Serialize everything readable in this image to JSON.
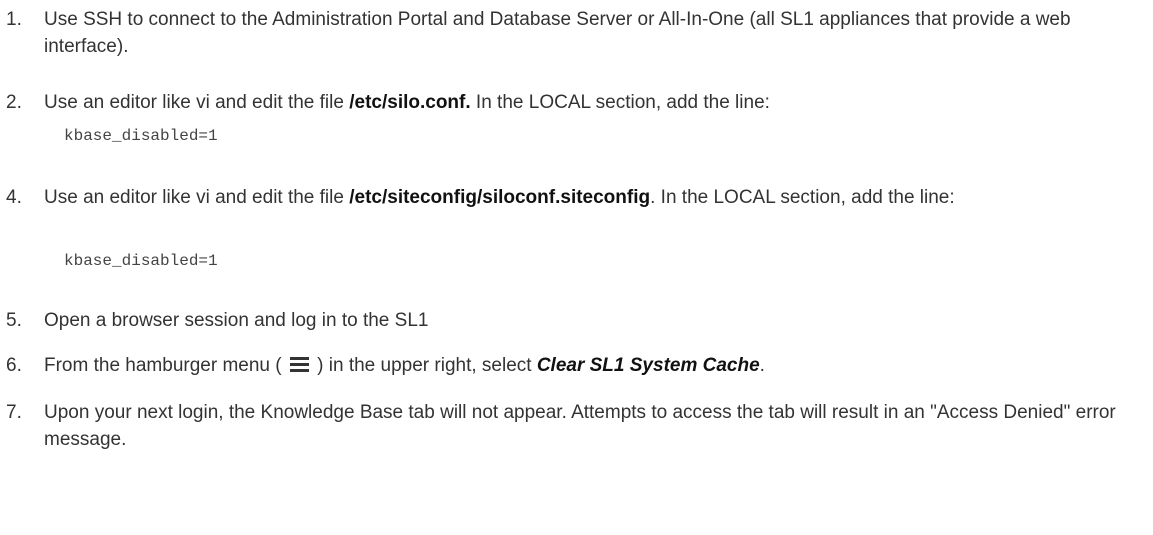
{
  "steps": [
    {
      "num": "1.",
      "text": "Use SSH to connect to the Administration Portal and Database Server or All-In-One (all SL1 appliances that provide a web interface)."
    },
    {
      "num": "2.",
      "pre": "Use an editor like vi and edit the file ",
      "path": "/etc/silo.conf.",
      "post": " In the LOCAL section, add the line:",
      "code": "kbase_disabled=1"
    },
    {
      "num": "4.",
      "pre": "Use an editor like vi and edit the file ",
      "path": "/etc/siteconfig/siloconf.siteconfig",
      "post": ". In the LOCAL section, add the line:",
      "code": "kbase_disabled=1"
    },
    {
      "num": "5.",
      "text": "Open a browser session and log in to the SL1"
    },
    {
      "num": "6.",
      "pre": "From the hamburger menu ( ",
      "icon": "hamburger-menu-icon",
      "mid": " ) in the upper right, select ",
      "emph": "Clear SL1 System Cache",
      "post": "."
    },
    {
      "num": "7.",
      "text": "Upon your next login, the Knowledge Base tab will not appear. Attempts to access the tab will result in an \"Access Denied\" error message."
    }
  ]
}
